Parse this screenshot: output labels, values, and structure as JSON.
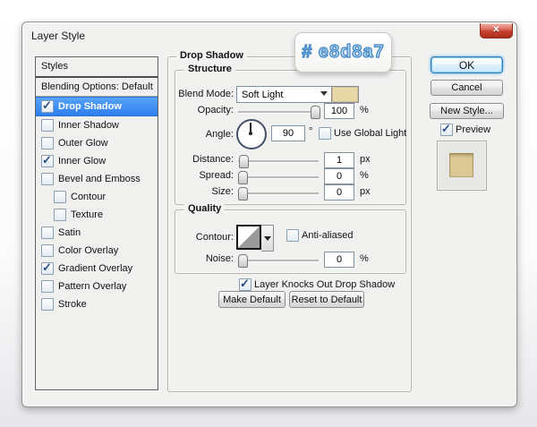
{
  "window": {
    "title": "Layer Style",
    "close_glyph": "✕"
  },
  "tooltip": {
    "text": "# e8d8a7"
  },
  "sidebar": {
    "header": "Styles",
    "blending": "Blending Options: Default",
    "items": [
      {
        "label": "Drop Shadow",
        "checked": true,
        "selected": true,
        "indent": false
      },
      {
        "label": "Inner Shadow",
        "checked": false,
        "selected": false,
        "indent": false
      },
      {
        "label": "Outer Glow",
        "checked": false,
        "selected": false,
        "indent": false
      },
      {
        "label": "Inner Glow",
        "checked": true,
        "selected": false,
        "indent": false
      },
      {
        "label": "Bevel and Emboss",
        "checked": false,
        "selected": false,
        "indent": false
      },
      {
        "label": "Contour",
        "checked": false,
        "selected": false,
        "indent": true
      },
      {
        "label": "Texture",
        "checked": false,
        "selected": false,
        "indent": true
      },
      {
        "label": "Satin",
        "checked": false,
        "selected": false,
        "indent": false
      },
      {
        "label": "Color Overlay",
        "checked": false,
        "selected": false,
        "indent": false
      },
      {
        "label": "Gradient Overlay",
        "checked": true,
        "selected": false,
        "indent": false
      },
      {
        "label": "Pattern Overlay",
        "checked": false,
        "selected": false,
        "indent": false
      },
      {
        "label": "Stroke",
        "checked": false,
        "selected": false,
        "indent": false
      }
    ]
  },
  "panel": {
    "title": "Drop Shadow",
    "structure": {
      "title": "Structure",
      "blend_mode_label": "Blend Mode:",
      "blend_mode_value": "Soft Light",
      "opacity_label": "Opacity:",
      "opacity_value": "100",
      "opacity_unit": "%",
      "angle_label": "Angle:",
      "angle_value": "90",
      "angle_unit": "°",
      "use_global_light_label": "Use Global Light",
      "distance_label": "Distance:",
      "distance_value": "1",
      "distance_unit": "px",
      "spread_label": "Spread:",
      "spread_value": "0",
      "spread_unit": "%",
      "size_label": "Size:",
      "size_value": "0",
      "size_unit": "px"
    },
    "quality": {
      "title": "Quality",
      "contour_label": "Contour:",
      "anti_aliased_label": "Anti-aliased",
      "noise_label": "Noise:",
      "noise_value": "0",
      "noise_unit": "%"
    },
    "knockout_label": "Layer Knocks Out Drop Shadow",
    "make_default_label": "Make Default",
    "reset_default_label": "Reset to Default"
  },
  "actions": {
    "ok": "OK",
    "cancel": "Cancel",
    "new_style": "New Style...",
    "preview_label": "Preview"
  },
  "checks": {
    "use_global_light": false,
    "anti_aliased": false,
    "knockout": true,
    "preview": true
  },
  "colors": {
    "selection_blue": "#3d8ef2",
    "blend_swatch": "#e8d8a7",
    "preview_swatch": "#dcca96"
  }
}
